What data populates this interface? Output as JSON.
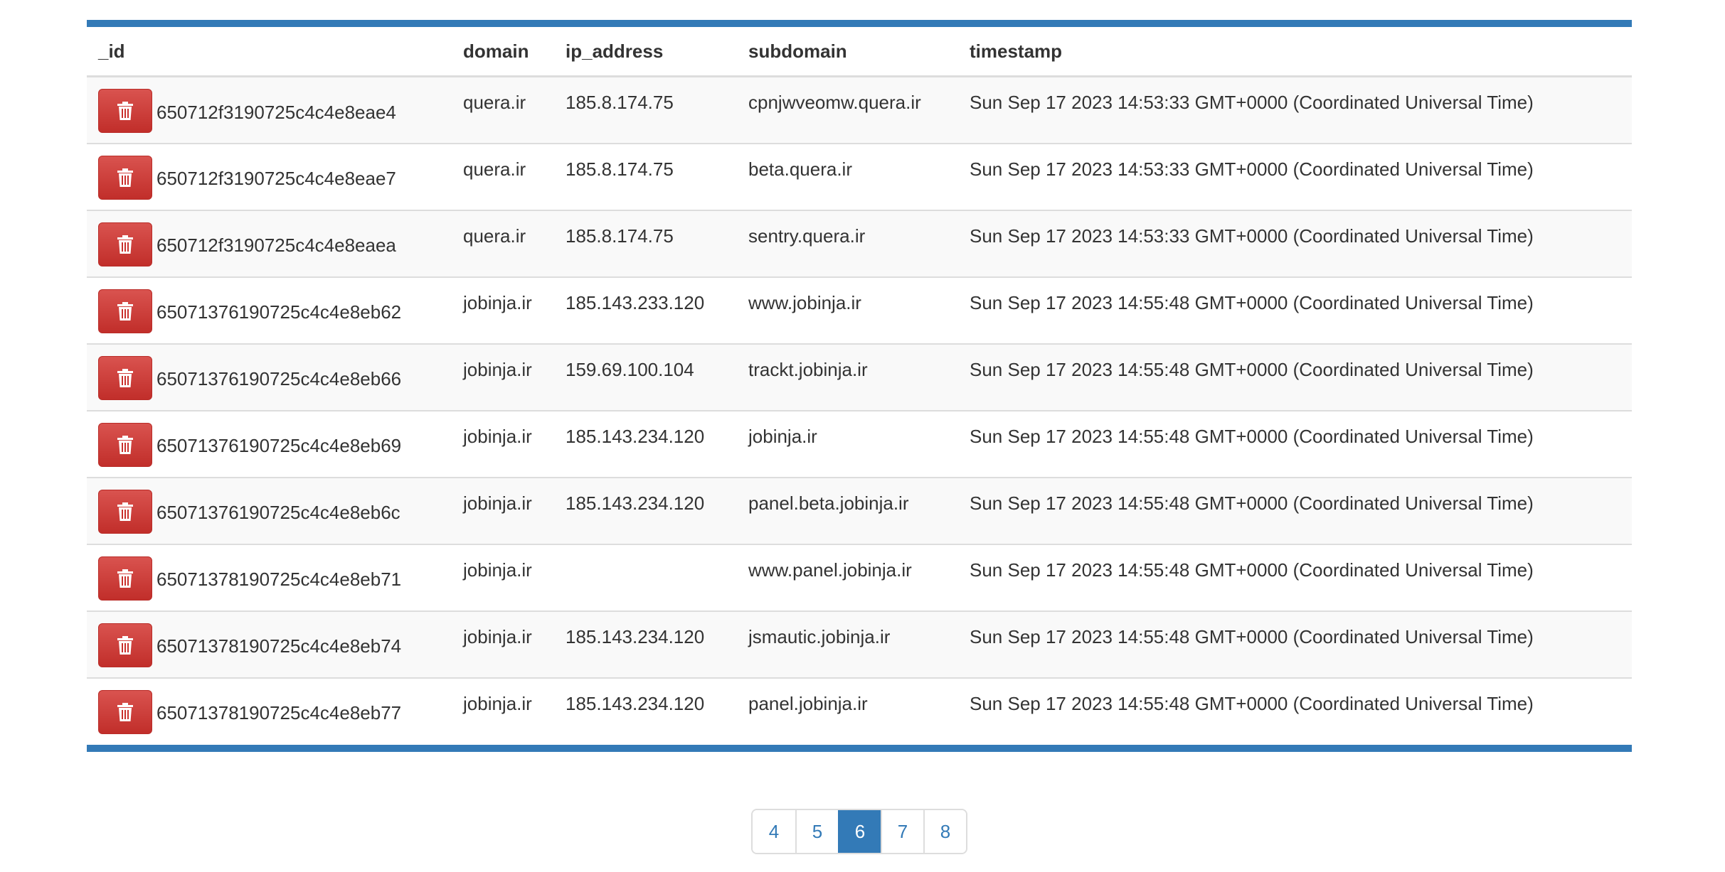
{
  "table": {
    "headers": {
      "id": "_id",
      "domain": "domain",
      "ip_address": "ip_address",
      "subdomain": "subdomain",
      "timestamp": "timestamp"
    },
    "rows": [
      {
        "id": "650712f3190725c4c4e8eae4",
        "domain": "quera.ir",
        "ip_address": "185.8.174.75",
        "subdomain": "cpnjwveomw.quera.ir",
        "timestamp": "Sun Sep 17 2023 14:53:33 GMT+0000 (Coordinated Universal Time)"
      },
      {
        "id": "650712f3190725c4c4e8eae7",
        "domain": "quera.ir",
        "ip_address": "185.8.174.75",
        "subdomain": "beta.quera.ir",
        "timestamp": "Sun Sep 17 2023 14:53:33 GMT+0000 (Coordinated Universal Time)"
      },
      {
        "id": "650712f3190725c4c4e8eaea",
        "domain": "quera.ir",
        "ip_address": "185.8.174.75",
        "subdomain": "sentry.quera.ir",
        "timestamp": "Sun Sep 17 2023 14:53:33 GMT+0000 (Coordinated Universal Time)"
      },
      {
        "id": "65071376190725c4c4e8eb62",
        "domain": "jobinja.ir",
        "ip_address": "185.143.233.120",
        "subdomain": "www.jobinja.ir",
        "timestamp": "Sun Sep 17 2023 14:55:48 GMT+0000 (Coordinated Universal Time)"
      },
      {
        "id": "65071376190725c4c4e8eb66",
        "domain": "jobinja.ir",
        "ip_address": "159.69.100.104",
        "subdomain": "trackt.jobinja.ir",
        "timestamp": "Sun Sep 17 2023 14:55:48 GMT+0000 (Coordinated Universal Time)"
      },
      {
        "id": "65071376190725c4c4e8eb69",
        "domain": "jobinja.ir",
        "ip_address": "185.143.234.120",
        "subdomain": "jobinja.ir",
        "timestamp": "Sun Sep 17 2023 14:55:48 GMT+0000 (Coordinated Universal Time)"
      },
      {
        "id": "65071376190725c4c4e8eb6c",
        "domain": "jobinja.ir",
        "ip_address": "185.143.234.120",
        "subdomain": "panel.beta.jobinja.ir",
        "timestamp": "Sun Sep 17 2023 14:55:48 GMT+0000 (Coordinated Universal Time)"
      },
      {
        "id": "65071378190725c4c4e8eb71",
        "domain": "jobinja.ir",
        "ip_address": "",
        "subdomain": "www.panel.jobinja.ir",
        "timestamp": "Sun Sep 17 2023 14:55:48 GMT+0000 (Coordinated Universal Time)"
      },
      {
        "id": "65071378190725c4c4e8eb74",
        "domain": "jobinja.ir",
        "ip_address": "185.143.234.120",
        "subdomain": "jsmautic.jobinja.ir",
        "timestamp": "Sun Sep 17 2023 14:55:48 GMT+0000 (Coordinated Universal Time)"
      },
      {
        "id": "65071378190725c4c4e8eb77",
        "domain": "jobinja.ir",
        "ip_address": "185.143.234.120",
        "subdomain": "panel.jobinja.ir",
        "timestamp": "Sun Sep 17 2023 14:55:48 GMT+0000 (Coordinated Universal Time)"
      }
    ],
    "delete_icon": "trash-icon"
  },
  "pagination": {
    "pages": [
      "4",
      "5",
      "6",
      "7",
      "8"
    ],
    "active": "6"
  },
  "colors": {
    "accent": "#337ab7",
    "danger": "#d9534f",
    "row_stripe": "#f9f9f9",
    "border": "#dddddd"
  }
}
